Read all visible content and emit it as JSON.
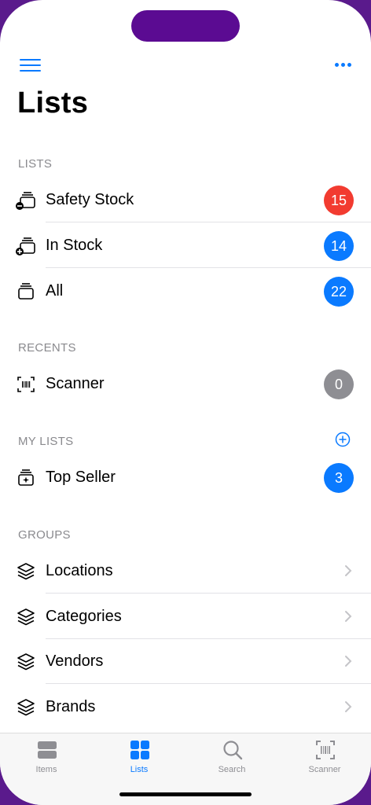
{
  "header": {
    "title": "Lists"
  },
  "sections": {
    "lists": "LISTS",
    "recents": "RECENTS",
    "my_lists": "MY LISTS",
    "groups": "GROUPS"
  },
  "lists": [
    {
      "label": "Safety Stock",
      "count": "15",
      "color": "#f23b30"
    },
    {
      "label": "In Stock",
      "count": "14",
      "color": "#0a7aff"
    },
    {
      "label": "All",
      "count": "22",
      "color": "#0a7aff"
    }
  ],
  "recents": [
    {
      "label": "Scanner",
      "count": "0",
      "color": "#8e8e93"
    }
  ],
  "my_lists": [
    {
      "label": "Top Seller",
      "count": "3",
      "color": "#0a7aff"
    }
  ],
  "groups": [
    {
      "label": "Locations"
    },
    {
      "label": "Categories"
    },
    {
      "label": "Vendors"
    },
    {
      "label": "Brands"
    }
  ],
  "tabbar": {
    "items": {
      "label": "Items"
    },
    "lists": {
      "label": "Lists"
    },
    "search": {
      "label": "Search"
    },
    "scanner": {
      "label": "Scanner"
    }
  },
  "colors": {
    "accent": "#0a7aff",
    "danger": "#f23b30",
    "gray": "#8e8e93"
  }
}
